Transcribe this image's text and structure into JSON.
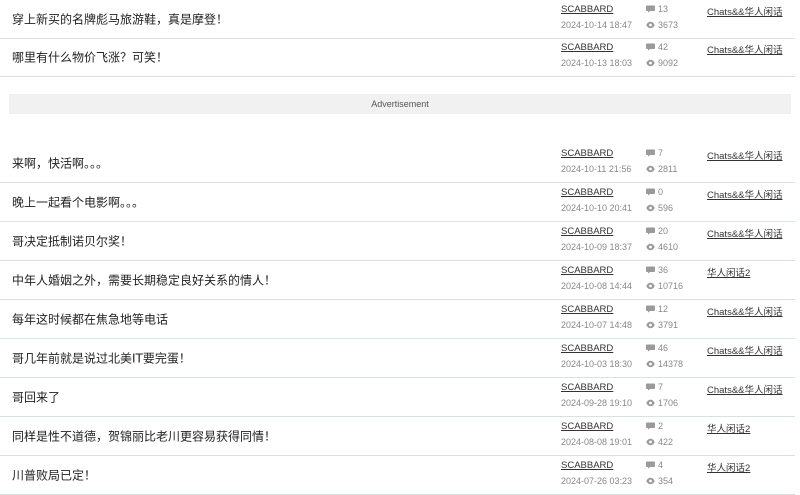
{
  "advertisement_label": "Advertisement",
  "threads": [
    {
      "title": "穿上新买的名牌彪马旅游鞋，真是摩登！",
      "author": "SCABBARD",
      "date": "2024-10-14 18:47",
      "replies": "13",
      "views": "3673",
      "board": "Chats&&华人闲话"
    },
    {
      "title": "哪里有什么物价飞涨？可笑！",
      "author": "SCABBARD",
      "date": "2024-10-13 18:03",
      "replies": "42",
      "views": "9092",
      "board": "Chats&&华人闲话"
    },
    {
      "title": "来啊，快活啊。。。",
      "author": "SCABBARD",
      "date": "2024-10-11 21:56",
      "replies": "7",
      "views": "2811",
      "board": "Chats&&华人闲话"
    },
    {
      "title": "晚上一起看个电影啊。。。",
      "author": "SCABBARD",
      "date": "2024-10-10 20:41",
      "replies": "0",
      "views": "596",
      "board": "Chats&&华人闲话"
    },
    {
      "title": "哥决定抵制诺贝尔奖！",
      "author": "SCABBARD",
      "date": "2024-10-09 18:37",
      "replies": "20",
      "views": "4610",
      "board": "Chats&&华人闲话"
    },
    {
      "title": "中年人婚姻之外，需要长期稳定良好关系的情人！",
      "author": "SCABBARD",
      "date": "2024-10-08 14:44",
      "replies": "36",
      "views": "10716",
      "board": "华人闲话2"
    },
    {
      "title": "每年这时候都在焦急地等电话",
      "author": "SCABBARD",
      "date": "2024-10-07 14:48",
      "replies": "12",
      "views": "3791",
      "board": "Chats&&华人闲话"
    },
    {
      "title": "哥几年前就是说过北美IT要完蛋！",
      "author": "SCABBARD",
      "date": "2024-10-03 18:30",
      "replies": "46",
      "views": "14378",
      "board": "Chats&&华人闲话"
    },
    {
      "title": "哥回来了",
      "author": "SCABBARD",
      "date": "2024-09-28 19:10",
      "replies": "7",
      "views": "1706",
      "board": "Chats&&华人闲话"
    },
    {
      "title": "同样是性不道德，贺锦丽比老川更容易获得同情！",
      "author": "SCABBARD",
      "date": "2024-08-08 19:01",
      "replies": "2",
      "views": "422",
      "board": "华人闲话2"
    },
    {
      "title": "川普败局已定！",
      "author": "SCABBARD",
      "date": "2024-07-26 03:23",
      "replies": "4",
      "views": "354",
      "board": "华人闲话2"
    }
  ]
}
